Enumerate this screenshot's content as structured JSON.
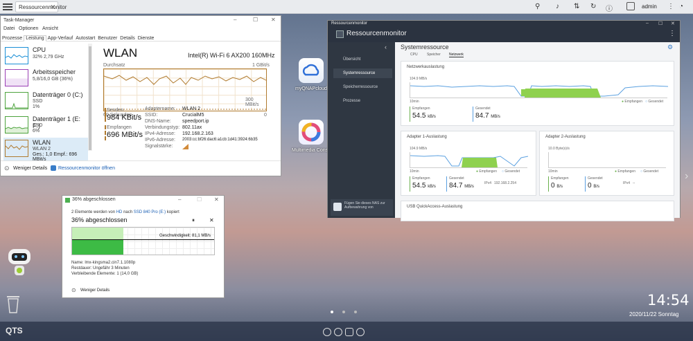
{
  "qts": {
    "tab_title": "Ressourcenmonitor",
    "admin": "admin",
    "clock": "14:54",
    "date": "2020/11/22 Sonntag",
    "logo": "QTS"
  },
  "desktop": {
    "icon1": "myQNAPcloud",
    "icon2": "Multimedia Conso"
  },
  "taskmanager": {
    "title": "Task-Manager",
    "menu": [
      "Datei",
      "Optionen",
      "Ansicht"
    ],
    "tabs": [
      "Prozesse",
      "Leistung",
      "App-Verlauf",
      "Autostart",
      "Benutzer",
      "Details",
      "Dienste"
    ],
    "side": [
      {
        "name": "CPU",
        "sub": "32% 2,79 GHz"
      },
      {
        "name": "Arbeitsspeicher",
        "sub": "5,8/16,0 GB (36%)"
      },
      {
        "name": "Datenträger 0 (C:)",
        "sub": "SSD",
        "sub2": "1%"
      },
      {
        "name": "Datenträger 1 (E: F:)",
        "sub": "SSD",
        "sub2": "6%"
      },
      {
        "name": "WLAN",
        "sub": "WLAN 2",
        "sub2": "Ges.: 1,0 Empf.: 696 MBit/s"
      }
    ],
    "heading": "WLAN",
    "adapter": "Intel(R) Wi-Fi 6 AX200 160MHz",
    "throughput": "Durchsatz",
    "max": "1 GBit/s",
    "mid": "300 MBit/s",
    "seconds": "60 Sekunden",
    "zero": "0",
    "send_label": "Senden",
    "send_val": "984 KBit/s",
    "recv_label": "Empfangen",
    "recv_val": "696 MBit/s",
    "details": [
      [
        "Adaptername:",
        "WLAN 2"
      ],
      [
        "SSID:",
        "CrucialM5"
      ],
      [
        "DNS-Name:",
        "speedport.ip"
      ],
      [
        "Verbindungstyp:",
        "802.11ax"
      ],
      [
        "IPv4-Adresse:",
        "192.168.2.163"
      ],
      [
        "IPv6-Adresse:",
        "2003:cc:bf26:dac6:a1cb:1d41:3924:6b35"
      ],
      [
        "Signalstärke:",
        ""
      ]
    ],
    "less": "Weniger Details",
    "open_rm": "Ressourcenmonitor öffnen"
  },
  "copy": {
    "title": "36% abgeschlossen",
    "line1_a": "2 Elemente werden von",
    "line1_b": "HD",
    "line1_c": "nach",
    "line1_d": "SSD 840 Pro (E:)",
    "line1_e": "kopiert",
    "pct": "36% abgeschlossen",
    "speed": "Geschwindigkeit: 81,1 MB/s",
    "name": "Name: lmx-kingsma2.cin7.1.1080p",
    "rest": "Restdauer: Ungefähr 3 Minuten",
    "remain": "Verbleibende Elemente: 1 (14,0 GB)",
    "less": "Weniger Details",
    "progress": 0.36
  },
  "rm": {
    "title": "Ressourcenmonitor",
    "header": "Ressourcenmonitor",
    "nav": [
      "Übersicht",
      "Systemressource",
      "Speicherressource",
      "Prozesse"
    ],
    "section": "Systemressource",
    "subtabs": [
      "CPU",
      "Speicher",
      "Netzwerk"
    ],
    "promo": "Fügen Sie dieses NAS zur Aufbewahrung von",
    "net": {
      "title": "Netzwerkauslastung",
      "ymax": "104.9 MB/s",
      "xmin": "10min",
      "leg_recv": "Empfangen",
      "leg_sent": "Gesendet",
      "recv_label": "Empfangen",
      "recv_val": "54.5",
      "recv_unit": "kB/s",
      "sent_label": "Gesendet",
      "sent_val": "84.7",
      "sent_unit": "MB/s"
    },
    "a1": {
      "title": "Adapter 1-Auslastung",
      "ymax": "104.9 MB/s",
      "xmin": "10min",
      "leg_recv": "Empfangen",
      "leg_sent": "Gesendet",
      "recv_label": "Empfangen",
      "recv_val": "54.5",
      "recv_unit": "kB/s",
      "sent_label": "Gesendet",
      "sent_val": "84.7",
      "sent_unit": "MB/s",
      "ip_label": "IPv4",
      "ip": "192.168.2.254"
    },
    "a2": {
      "title": "Adapter 2-Auslastung",
      "ymax": "10.0 Byte(s)/s",
      "xmin": "10min",
      "leg_recv": "Empfangen",
      "leg_sent": "Gesendet",
      "recv_label": "Empfangen",
      "recv_val": "0",
      "recv_unit": "B/s",
      "sent_label": "Gesendet",
      "sent_val": "0",
      "sent_unit": "B/s",
      "ip_label": "IPv4",
      "ip": "--"
    },
    "usb": {
      "title": "USB QuickAccess-Auslastung"
    }
  }
}
